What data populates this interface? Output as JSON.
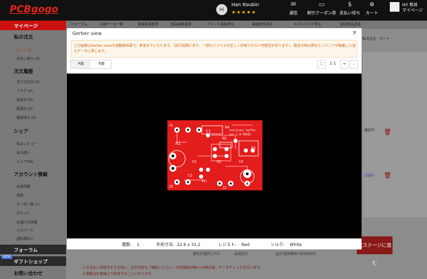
{
  "header": {
    "logo": "PCBgogo",
    "user_initials": "Hi",
    "user_name": "Han Koubin",
    "user_stars": "★★★★★",
    "icons": [
      {
        "name": "notification-icon",
        "label": "通信"
      },
      {
        "name": "coupon-icon",
        "label": "割引クーポン券"
      },
      {
        "name": "payment-icon",
        "label": "支払い待ち"
      },
      {
        "name": "cart-icon",
        "label": "カート"
      }
    ],
    "account_greeting": "Hi! 新井",
    "account_link": "マイページ"
  },
  "nav": {
    "items": [
      "フォーラム",
      "入稿データ一覧",
      "基板製造基準",
      "部品実装基準",
      "プリント基板発注",
      "実装案件発注",
      "メタルマスク発注",
      "個別部品調達"
    ]
  },
  "breadcrumb": "私の注文・カート",
  "sidebar": {
    "mypage": "マイページ",
    "sections": [
      {
        "title": "私の注文",
        "items": [
          "カート (2)",
          "支払い待ち (0)"
        ]
      },
      {
        "title": "注文履歴",
        "items": [
          "全ての注文 (0)",
          "フラグ (0)",
          "製造中 (0)",
          "配送中 (0)",
          "着荷済み (0)"
        ]
      },
      {
        "title": "シェア",
        "items": [
          "私のレビュー",
          "私の誘い",
          "シェアURL"
        ]
      },
      {
        "title": "アカウント情報",
        "items": [
          "会員情報",
          "残高",
          "クーポン券 (1)",
          "ポイント",
          "お届け先情報",
          "パスワード",
          "送料風払い"
        ]
      }
    ],
    "bottom": [
      "フォーラム",
      "ギフトショップ",
      "お問い合わせ"
    ],
    "new_badge": "NEW"
  },
  "background": {
    "status_text": "確認中",
    "link_text": "詳細を",
    "proceed_button": "次ステージに進む",
    "member_info": "業件が選択された",
    "member_status": "会員割引",
    "total": "合計(送料無料) 約4090円",
    "notes": [
      "1.お支払い手続きをする前に、注文内容をご確認ください。日本時間10時〜24時の間、データチェックを行います。",
      "2.関税はお客様より負担することになります。"
    ]
  },
  "modal": {
    "title": "Gerber view",
    "close": "×",
    "notice": "この画像はGerber viewの自動解析図で、参考までとなります。（試行段階にあり、一部のファイルが正しく反映されない可能性があります）。製造の時は弊社エンジニアが編集した加工データに準じます。",
    "tabs": [
      "A面",
      "B面"
    ],
    "zoom": {
      "fit": "⛶",
      "ratio": "1:1",
      "plus": "+",
      "minus": "-"
    },
    "info": {
      "layers_label": "層数:",
      "layers_value": "1",
      "size_label": "外形寸法:",
      "size_value": "22.6 x 31.2",
      "resist_label": "レジスト:",
      "resist_value": "Red",
      "silk_label": "シルク:",
      "silk_value": "White"
    }
  },
  "board": {
    "labels": {
      "j1": "J1",
      "c1": "C1",
      "r1": "R1",
      "r2": "R2",
      "r3": "R3",
      "r4": "R4",
      "u1": "U1",
      "c2": "C2",
      "c3": "C3",
      "c4": "C4",
      "j2": "J2",
      "j3": "J3",
      "rv": "RV1",
      "title": "nonlinear buffer",
      "ver": "ver 1.0 REV01"
    }
  },
  "colors": {
    "brand_red": "#e0251b",
    "pcb_red": "#e31c1c",
    "notice_text": "#c96a1a",
    "star": "#f4b400"
  }
}
